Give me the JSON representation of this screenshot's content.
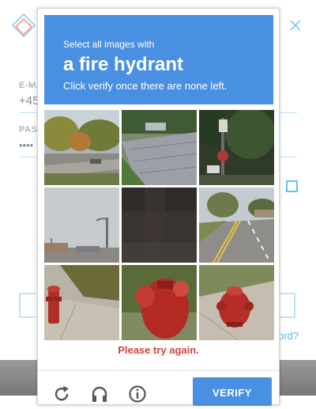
{
  "background": {
    "email_label": "E-MA",
    "email_value": "+45",
    "password_label": "PASS",
    "password_value": "••••",
    "forgot_link": "ord?"
  },
  "captcha": {
    "instruction_line1": "Select all images with",
    "target_object": "a fire hydrant",
    "instruction_line2": "Click verify once there are none left.",
    "tiles": [
      {
        "name": "tile-street-trees"
      },
      {
        "name": "tile-cobblestone-road"
      },
      {
        "name": "tile-stop-sign-trees"
      },
      {
        "name": "tile-street-light-pole"
      },
      {
        "name": "tile-dark-pavement"
      },
      {
        "name": "tile-road-lane-lines"
      },
      {
        "name": "tile-hydrant-sidewalk-grass"
      },
      {
        "name": "tile-hydrant-closeup"
      },
      {
        "name": "tile-hydrant-on-pavement"
      }
    ],
    "error_message": "Please try again.",
    "verify_label": "VERIFY",
    "icons": [
      "reload-icon",
      "audio-icon",
      "info-icon"
    ],
    "colors": {
      "accent": "#4a90e2",
      "error": "#d0443c"
    }
  }
}
